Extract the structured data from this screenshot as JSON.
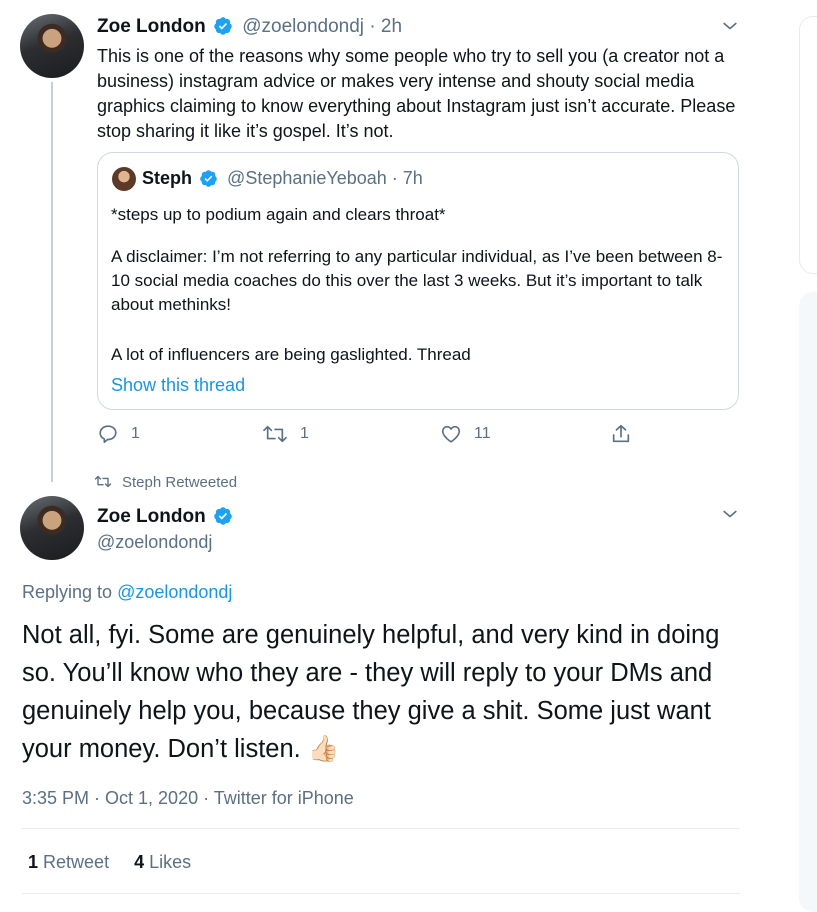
{
  "tweet1": {
    "author_name": "Zoe London",
    "handle": "@zoelondondj",
    "time": "· 2h",
    "text": "This is one of the reasons why some people who try to sell you (a creator not a business) instagram advice or makes very intense and shouty social media graphics claiming to know everything about Instagram just isn’t accurate. Please stop sharing it like it’s gospel. It’s not.",
    "quote": {
      "author_name": "Steph",
      "handle": "@StephanieYeboah · 7h",
      "line1": "*steps up to podium again and clears throat*",
      "line2": "A disclaimer: I’m not referring to any particular individual, as I’ve been between 8-10 social media coaches do this over the last 3 weeks. But it’s important to talk about methinks!",
      "line3": "A lot of influencers are being gaslighted. Thread",
      "show_thread": "Show this thread"
    },
    "actions": {
      "replies": "1",
      "retweets": "1",
      "likes": "11"
    }
  },
  "retweet_banner": "Steph Retweeted",
  "tweet2": {
    "author_name": "Zoe London",
    "handle": "@zoelondondj",
    "replying_prefix": "Replying to",
    "replying_handle": "@zoelondondj",
    "text": "Not all, fyi. Some are genuinely helpful, and very kind in doing so. You’ll know who they are - they will reply to your DMs and genuinely help you, because they give a shit. Some just want your money. Don’t listen.",
    "emoji": "👍🏻",
    "timestamp": "3:35 PM · Oct 1, 2020 · Twitter for iPhone",
    "stats": {
      "retweets_count": "1",
      "retweets_label": "Retweet",
      "likes_count": "4",
      "likes_label": "Likes"
    }
  },
  "icons": {
    "verified": "verified-badge-icon",
    "reply": "reply-icon",
    "retweet": "retweet-icon",
    "like": "heart-icon",
    "share": "share-icon",
    "chevron": "chevron-down-icon"
  },
  "colors": {
    "verified": "#1da1f2",
    "link": "#1b95e0",
    "muted": "#5b7083"
  }
}
